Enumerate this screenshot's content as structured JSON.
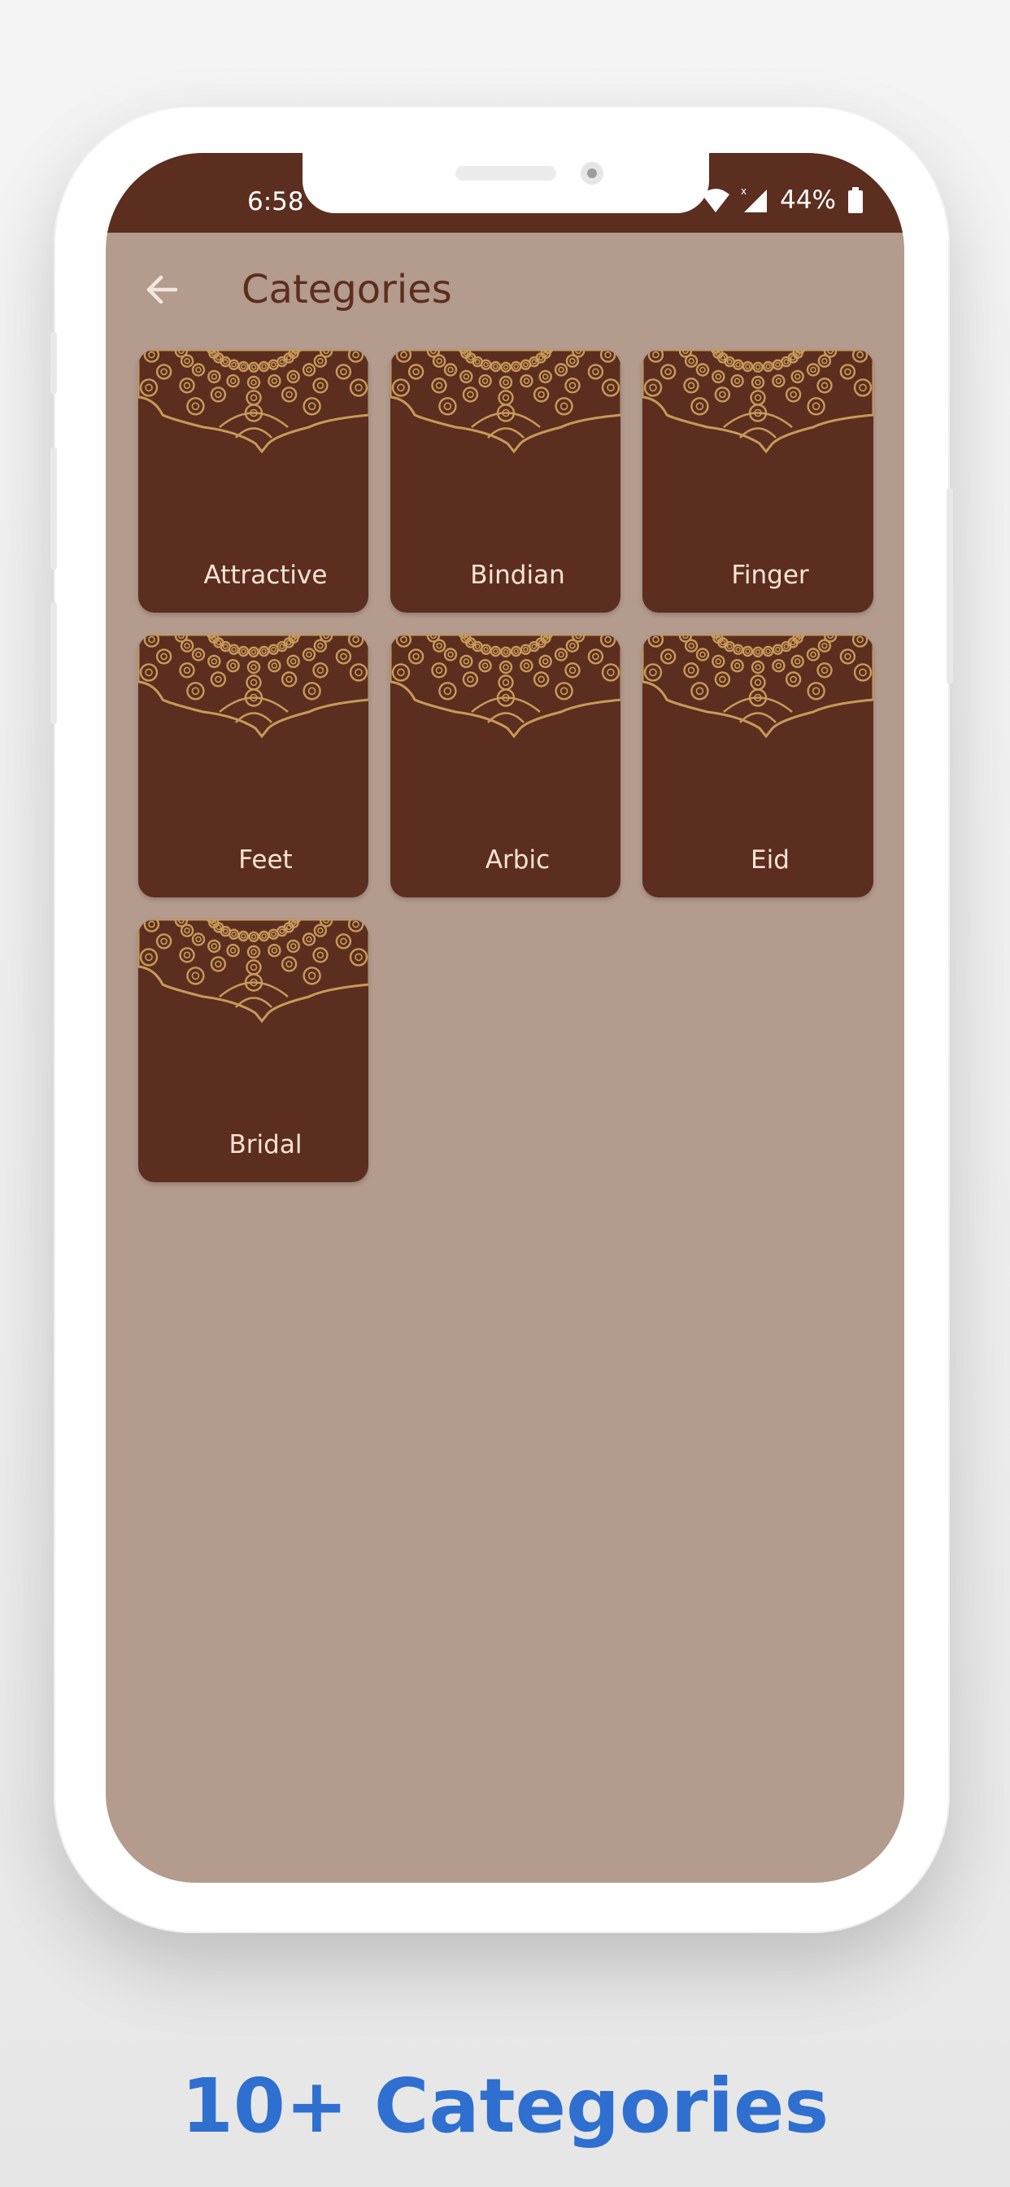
{
  "status_bar": {
    "time": "6:58",
    "battery": "44%"
  },
  "app_bar": {
    "title": "Categories",
    "back_icon": "arrow-left-icon"
  },
  "categories": [
    {
      "label": "Attractive"
    },
    {
      "label": "Bindian"
    },
    {
      "label": "Finger"
    },
    {
      "label": "Feet"
    },
    {
      "label": "Arbic"
    },
    {
      "label": "Eid"
    },
    {
      "label": "Bridal"
    }
  ],
  "promo": {
    "text": "10+ Categories"
  },
  "colors": {
    "primary": "#5c2e1f",
    "background": "#b39b8d",
    "accent_gold": "#c89a5a",
    "promo_blue": "#2e6fd0",
    "card_text": "#fbe3d2"
  }
}
